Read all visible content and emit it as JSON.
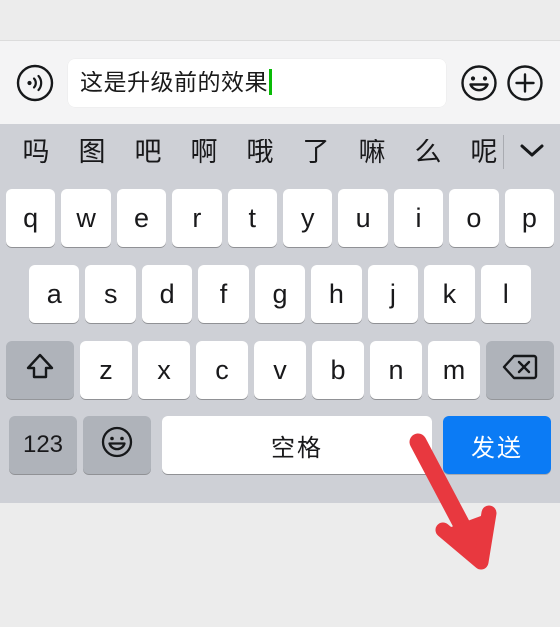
{
  "app": {
    "name": "wechat-chat-input",
    "background_color": "#ececec"
  },
  "input_bar": {
    "voice_icon": "voice-input-icon",
    "text_value": "这是升级前的效果",
    "placeholder": "",
    "caret_color": "#09bb07",
    "emoji_icon": "smiley-icon",
    "add_icon": "plus-icon",
    "field_background": "#ffffff"
  },
  "keyboard": {
    "background_color": "#ced0d6",
    "key_color": "#ffffff",
    "function_key_color": "#afb3ba",
    "candidates": [
      {
        "text": "吗"
      },
      {
        "text": "图"
      },
      {
        "text": "吧"
      },
      {
        "text": "啊"
      },
      {
        "text": "哦"
      },
      {
        "text": "了"
      },
      {
        "text": "嘛"
      },
      {
        "text": "么"
      },
      {
        "text": "呢"
      }
    ],
    "expand_icon": "chevron-down-icon",
    "row1": [
      {
        "label": "q"
      },
      {
        "label": "w"
      },
      {
        "label": "e"
      },
      {
        "label": "r"
      },
      {
        "label": "t"
      },
      {
        "label": "y"
      },
      {
        "label": "u"
      },
      {
        "label": "i"
      },
      {
        "label": "o"
      },
      {
        "label": "p"
      }
    ],
    "row2": [
      {
        "label": "a"
      },
      {
        "label": "s"
      },
      {
        "label": "d"
      },
      {
        "label": "f"
      },
      {
        "label": "g"
      },
      {
        "label": "h"
      },
      {
        "label": "j"
      },
      {
        "label": "k"
      },
      {
        "label": "l"
      }
    ],
    "row3": {
      "shift_icon": "shift-up-arrow-icon",
      "letters": [
        {
          "label": "z"
        },
        {
          "label": "x"
        },
        {
          "label": "c"
        },
        {
          "label": "v"
        },
        {
          "label": "b"
        },
        {
          "label": "n"
        },
        {
          "label": "m"
        }
      ],
      "backspace_icon": "backspace-delete-icon"
    },
    "row4": {
      "numeric_label": "123",
      "emoji_icon": "emoji-smiley-icon",
      "space_label": "空格",
      "send_label": "发送",
      "send_color": "#0b7bf5"
    }
  },
  "annotation": {
    "arrow_color": "#e8383f",
    "arrow_target": "send-button"
  }
}
